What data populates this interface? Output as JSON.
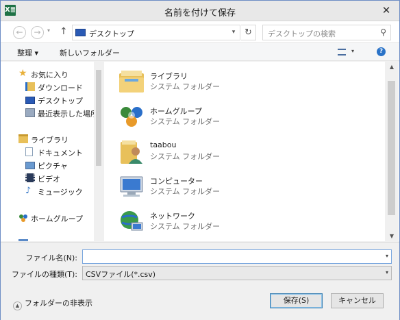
{
  "window": {
    "title": "名前を付けて保存",
    "app_icon": "X≣",
    "close": "✕"
  },
  "nav": {
    "back": "←",
    "forward": "→",
    "recent": "▾",
    "up": "↑",
    "address": "デスクトップ",
    "address_arrow": "▾",
    "refresh": "↻",
    "search_placeholder": "デスクトップの検索",
    "search_icon": "⚲"
  },
  "toolbar": {
    "organize": "整理 ▾",
    "new_folder": "新しいフォルダー",
    "view_arrow": "▾",
    "help": "?"
  },
  "sidebar": {
    "items": [
      {
        "label": "お気に入り",
        "icon": "star-icon",
        "color": "#e8b03a"
      },
      {
        "label": "ダウンロード",
        "icon": "download-folder-icon",
        "color": "#2a6fc9"
      },
      {
        "label": "デスクトップ",
        "icon": "desktop-icon",
        "color": "#2a5ab5"
      },
      {
        "label": "最近表示した場所",
        "icon": "recent-places-icon",
        "color": "#7a8aa0"
      },
      {
        "label": "ライブラリ",
        "icon": "library-icon",
        "color": "#e8c05a"
      },
      {
        "label": "ドキュメント",
        "icon": "documents-icon",
        "color": "#8aa0b8"
      },
      {
        "label": "ピクチャ",
        "icon": "pictures-icon",
        "color": "#4a7ab8"
      },
      {
        "label": "ビデオ",
        "icon": "videos-icon",
        "color": "#2a3a5a"
      },
      {
        "label": "ミュージック",
        "icon": "music-icon",
        "color": "#3a7ac8"
      },
      {
        "label": "ホームグループ",
        "icon": "homegroup-icon",
        "color": "#3a8a3a"
      }
    ]
  },
  "files": [
    {
      "name": "ライブラリ",
      "type": "システム フォルダー",
      "icon": "library-folder-icon"
    },
    {
      "name": "ホームグループ",
      "type": "システム フォルダー",
      "icon": "homegroup-icon"
    },
    {
      "name": "taabou",
      "type": "システム フォルダー",
      "icon": "user-folder-icon"
    },
    {
      "name": "コンピューター",
      "type": "システム フォルダー",
      "icon": "computer-icon"
    },
    {
      "name": "ネットワーク",
      "type": "システム フォルダー",
      "icon": "network-icon"
    }
  ],
  "form": {
    "filename_label": "ファイル名(N):",
    "filename_value": "",
    "filetype_label": "ファイルの種類(T):",
    "filetype_value": "CSVファイル(*.csv)",
    "dropdown_arrow": "▾",
    "hide_folders": "フォルダーの非表示",
    "hide_icon": "▲",
    "save": "保存(S)",
    "cancel": "キャンセル"
  }
}
